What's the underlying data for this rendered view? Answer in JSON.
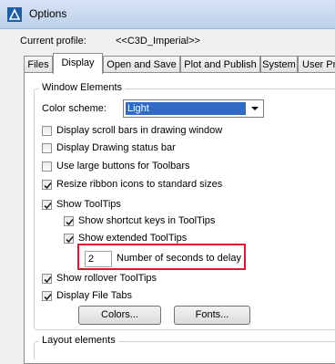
{
  "window": {
    "title": "Options"
  },
  "profile": {
    "label": "Current profile:",
    "value": "<<C3D_Imperial>>"
  },
  "tabs": [
    {
      "label": "Files"
    },
    {
      "label": "Display"
    },
    {
      "label": "Open and Save"
    },
    {
      "label": "Plot and Publish"
    },
    {
      "label": "System"
    },
    {
      "label": "User Pre"
    }
  ],
  "window_elements": {
    "title": "Window Elements",
    "color_scheme_label": "Color scheme:",
    "color_scheme_value": "Light",
    "checkboxes": [
      {
        "label": "Display scroll bars in drawing window",
        "checked": false
      },
      {
        "label": "Display Drawing status bar",
        "checked": false
      },
      {
        "label": "Use large buttons for Toolbars",
        "checked": false
      },
      {
        "label": "Resize ribbon icons to standard sizes",
        "checked": true
      },
      {
        "label": "Show ToolTips",
        "checked": true
      },
      {
        "label": "Show shortcut keys in ToolTips",
        "checked": true
      },
      {
        "label": "Show extended ToolTips",
        "checked": true
      },
      {
        "label": "Show rollover ToolTips",
        "checked": true
      },
      {
        "label": "Display File Tabs",
        "checked": true
      }
    ],
    "delay_value": "2",
    "delay_label": "Number of seconds to delay",
    "colors_button": "Colors...",
    "fonts_button": "Fonts..."
  },
  "layout_elements": {
    "title": "Layout elements"
  },
  "colors": {
    "highlight": "#316ac5",
    "callout": "#e0182a"
  }
}
